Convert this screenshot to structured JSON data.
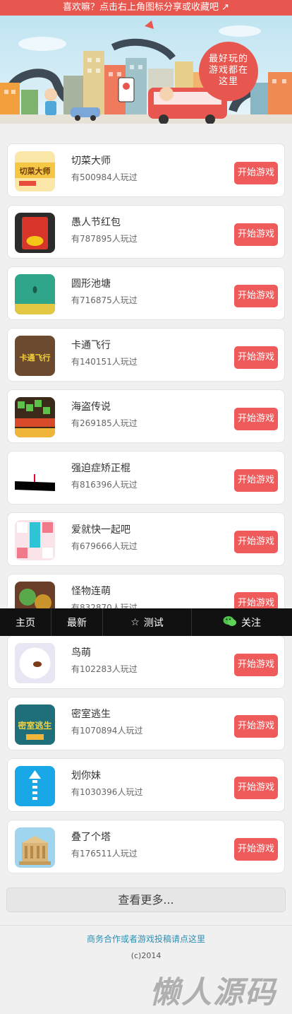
{
  "top_tip": "喜欢嘛？点击右上角图标分享或收藏吧 ↗",
  "hero": {
    "bubble_lines": [
      "最好玩的",
      "游戏都在",
      "这里"
    ]
  },
  "games": [
    {
      "name": "切菜大师",
      "plays": "有500984人玩过",
      "button": "开始游戏",
      "thumb_text": "切菜大师"
    },
    {
      "name": "愚人节红包",
      "plays": "有787895人玩过",
      "button": "开始游戏"
    },
    {
      "name": "圆形池塘",
      "plays": "有716875人玩过",
      "button": "开始游戏"
    },
    {
      "name": "卡通飞行",
      "plays": "有140151人玩过",
      "button": "开始游戏",
      "thumb_text": "卡通飞行"
    },
    {
      "name": "海盗传说",
      "plays": "有269185人玩过",
      "button": "开始游戏"
    },
    {
      "name": "强迫症矫正棍",
      "plays": "有816396人玩过",
      "button": "开始游戏"
    },
    {
      "name": "爱就快一起吧",
      "plays": "有679666人玩过",
      "button": "开始游戏"
    },
    {
      "name": "怪物连萌",
      "plays": "有832870人玩过",
      "button": "开始游戏"
    },
    {
      "name": "鸟萌",
      "plays": "有102283人玩过",
      "button": "开始游戏"
    },
    {
      "name": "密室逃生",
      "plays": "有1070894人玩过",
      "button": "开始游戏",
      "thumb_text": "密室逃生"
    },
    {
      "name": "划你妹",
      "plays": "有1030396人玩过",
      "button": "开始游戏"
    },
    {
      "name": "叠了个塔",
      "plays": "有176511人玩过",
      "button": "开始游戏"
    }
  ],
  "nav": {
    "home": "主页",
    "latest": "最新",
    "test": "测试",
    "test_icon": "star-icon",
    "follow": "关注",
    "follow_icon": "wechat-icon"
  },
  "more_button": "查看更多...",
  "footer_link": "商务合作或者游戏投稿请点这里",
  "copyright": "(c)2014",
  "watermark": "懒人源码",
  "colors": {
    "accent_red": "#e8574f",
    "button_red": "#ef5a5a",
    "link_blue": "#2a8fb5",
    "nav_black": "#111111"
  }
}
